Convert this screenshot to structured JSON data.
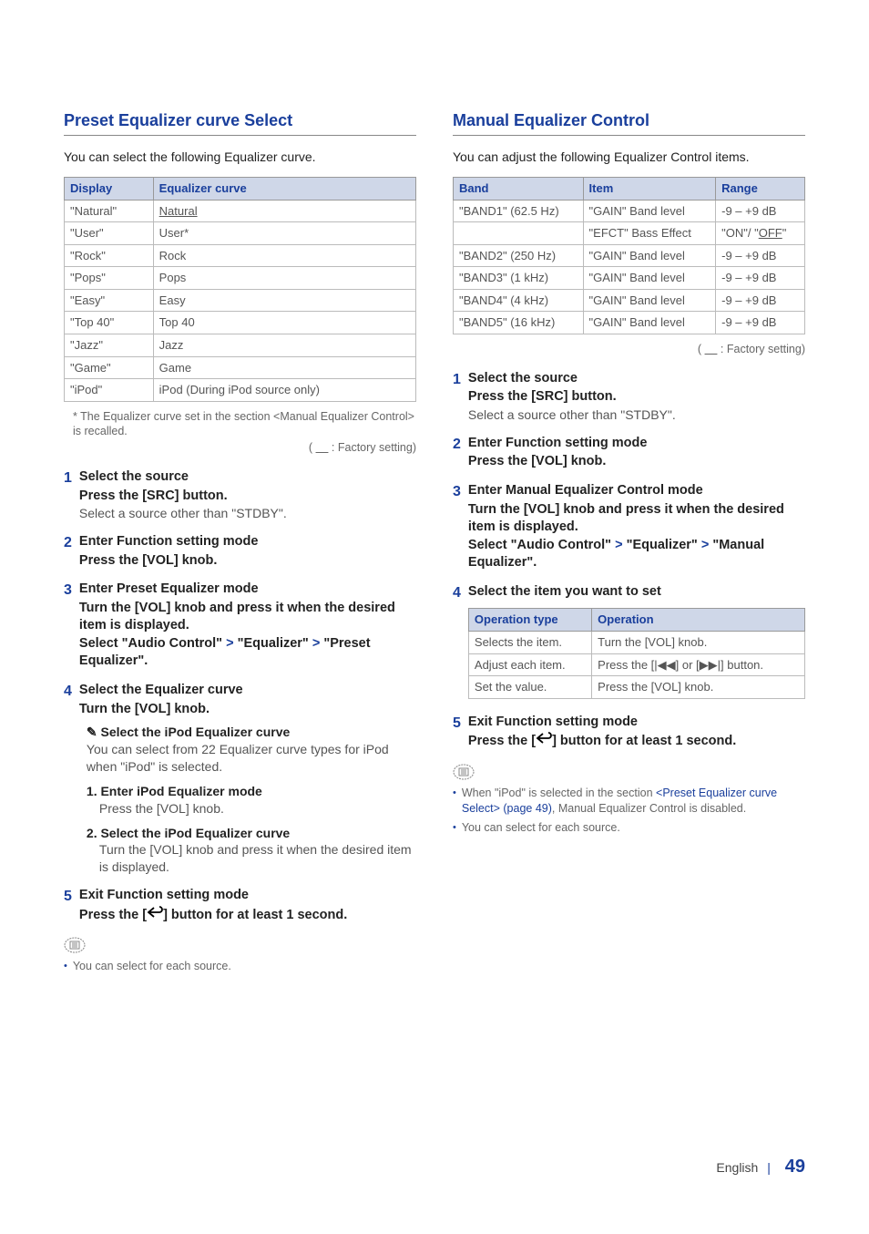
{
  "left": {
    "title": "Preset Equalizer curve Select",
    "intro": "You can select the following Equalizer curve.",
    "table_headers": [
      "Display",
      "Equalizer curve"
    ],
    "table_rows": [
      [
        "\"Natural\"",
        "Natural"
      ],
      [
        "\"User\"",
        "User*"
      ],
      [
        "\"Rock\"",
        "Rock"
      ],
      [
        "\"Pops\"",
        "Pops"
      ],
      [
        "\"Easy\"",
        "Easy"
      ],
      [
        "\"Top 40\"",
        "Top 40"
      ],
      [
        "\"Jazz\"",
        "Jazz"
      ],
      [
        "\"Game\"",
        "Game"
      ],
      [
        "\"iPod\"",
        "iPod (During iPod source only)"
      ]
    ],
    "table_note": "* The Equalizer curve set in the section <Manual Equalizer Control> is recalled.",
    "factory": "( __ : Factory setting)",
    "steps": {
      "s1": {
        "num": "1",
        "head": "Select the source",
        "sub": "Press the [SRC] button.",
        "plain": "Select a source other than \"STDBY\"."
      },
      "s2": {
        "num": "2",
        "head": "Enter Function setting mode",
        "sub": "Press the [VOL] knob."
      },
      "s3": {
        "num": "3",
        "head": "Enter Preset Equalizer mode",
        "sub1": "Turn the [VOL] knob and press it when the desired item is displayed.",
        "sub2a": "Select \"Audio Control\"",
        "sub2b": "\"Equalizer\"",
        "sub2c": "\"Preset Equalizer\"."
      },
      "s4": {
        "num": "4",
        "head": "Select the Equalizer curve",
        "sub": "Turn the [VOL] knob.",
        "pencil": "✎ Select the iPod Equalizer curve",
        "pencil_plain": "You can select from 22 Equalizer curve types for iPod when \"iPod\" is selected.",
        "n1h": "1. Enter iPod Equalizer mode",
        "n1p": "Press the [VOL] knob.",
        "n2h": "2. Select the iPod Equalizer curve",
        "n2p": "Turn the [VOL] knob and press it when the desired item is displayed."
      },
      "s5": {
        "num": "5",
        "head": "Exit Function setting mode",
        "sub_a": "Press the [",
        "sub_b": "] button for at least 1 second."
      }
    },
    "note1": "You can select for each source."
  },
  "right": {
    "title": "Manual Equalizer Control",
    "intro": "You can adjust the following Equalizer Control items.",
    "table_headers": [
      "Band",
      "Item",
      "Range"
    ],
    "table_rows": [
      [
        "\"BAND1\" (62.5 Hz)",
        "\"GAIN\" Band level",
        "-9 – +9 dB"
      ],
      [
        "",
        "\"EFCT\" Bass Effect",
        "\"ON\"/ \"OFF\""
      ],
      [
        "\"BAND2\" (250 Hz)",
        "\"GAIN\" Band level",
        "-9 – +9 dB"
      ],
      [
        "\"BAND3\" (1 kHz)",
        "\"GAIN\" Band level",
        "-9 – +9 dB"
      ],
      [
        "\"BAND4\" (4 kHz)",
        "\"GAIN\" Band level",
        "-9 – +9 dB"
      ],
      [
        "\"BAND5\" (16 kHz)",
        "\"GAIN\" Band level",
        "-9 – +9 dB"
      ]
    ],
    "factory": "( __ : Factory setting)",
    "steps": {
      "s1": {
        "num": "1",
        "head": "Select the source",
        "sub": "Press the [SRC] button.",
        "plain": "Select a source other than \"STDBY\"."
      },
      "s2": {
        "num": "2",
        "head": "Enter Function setting mode",
        "sub": "Press the [VOL] knob."
      },
      "s3": {
        "num": "3",
        "head": "Enter Manual Equalizer Control mode",
        "sub1": "Turn the [VOL] knob and press it when the desired item is displayed.",
        "sub2a": "Select \"Audio Control\"",
        "sub2b": "\"Equalizer\"",
        "sub2c": "\"Manual Equalizer\"."
      },
      "s4": {
        "num": "4",
        "head": "Select the item you want to set",
        "op_headers": [
          "Operation type",
          "Operation"
        ],
        "op_rows": [
          [
            "Selects the item.",
            "Turn the [VOL] knob."
          ],
          [
            "Adjust each item.",
            "Press the [|◀◀] or [▶▶|] button."
          ],
          [
            "Set the value.",
            "Press the [VOL] knob."
          ]
        ]
      },
      "s5": {
        "num": "5",
        "head": "Exit Function setting mode",
        "sub_a": "Press the [",
        "sub_b": "] button for at least 1 second."
      }
    },
    "note1a": "When \"iPod\" is selected in the section ",
    "note1link": "<Preset Equalizer curve Select> (page 49)",
    "note1b": ", Manual Equalizer Control is disabled.",
    "note2": "You can select for each source."
  },
  "footer": {
    "lang": "English",
    "page": "49"
  }
}
